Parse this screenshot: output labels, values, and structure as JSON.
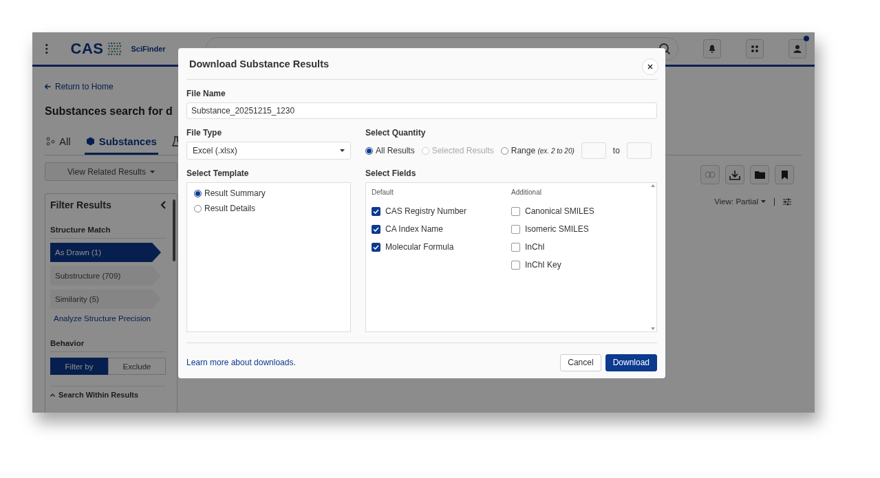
{
  "header": {
    "logo": "CAS",
    "product": "SciFinder"
  },
  "breadcrumb": "Return to Home",
  "page_title": "Substances search for d",
  "tabs": [
    {
      "label": "All",
      "selected": false
    },
    {
      "label": "Substances",
      "selected": true
    }
  ],
  "related_button": "View Related Results",
  "filter": {
    "title": "Filter Results",
    "structure_title": "Structure Match",
    "structure_items": [
      {
        "label": "As Drawn (1)",
        "selected": true
      },
      {
        "label": "Substructure (709)",
        "selected": false
      },
      {
        "label": "Similarity (5)",
        "selected": false
      }
    ],
    "link": "Analyze Structure Precision",
    "behavior_title": "Behavior",
    "behavior_options": [
      {
        "label": "Filter by",
        "selected": true
      },
      {
        "label": "Exclude",
        "selected": false
      }
    ],
    "search_within": "Search Within Results"
  },
  "view_menu": "View: Partial",
  "dialog": {
    "title": "Download Substance Results",
    "file_name": {
      "label": "File Name",
      "value": "Substance_20251215_1230"
    },
    "file_type": {
      "label": "File Type",
      "value": "Excel (.xlsx)"
    },
    "quantity": {
      "label": "Select Quantity",
      "options": [
        {
          "label": "All Results",
          "selected": true,
          "disabled": false
        },
        {
          "label": "Selected Results",
          "selected": false,
          "disabled": true
        },
        {
          "label": "Range",
          "hint": "(ex. 2 to 20)",
          "selected": false,
          "disabled": false
        }
      ],
      "to": "to"
    },
    "template": {
      "label": "Select Template",
      "options": [
        {
          "label": "Result Summary",
          "selected": true
        },
        {
          "label": "Result Details",
          "selected": false
        }
      ]
    },
    "fields": {
      "label": "Select Fields",
      "groups": [
        {
          "heading": "Default",
          "items": [
            {
              "label": "CAS Registry Number",
              "checked": true
            },
            {
              "label": "CA Index Name",
              "checked": true
            },
            {
              "label": "Molecular Formula",
              "checked": true
            }
          ]
        },
        {
          "heading": "Additional",
          "items": [
            {
              "label": "Canonical SMILES",
              "checked": false
            },
            {
              "label": "Isomeric SMILES",
              "checked": false
            },
            {
              "label": "InChI",
              "checked": false
            },
            {
              "label": "InChI Key",
              "checked": false
            }
          ]
        }
      ]
    },
    "footer_link": "Learn more about downloads.",
    "buttons": [
      {
        "label": "Cancel",
        "kind": "secondary"
      },
      {
        "label": "Download",
        "kind": "primary"
      }
    ]
  }
}
